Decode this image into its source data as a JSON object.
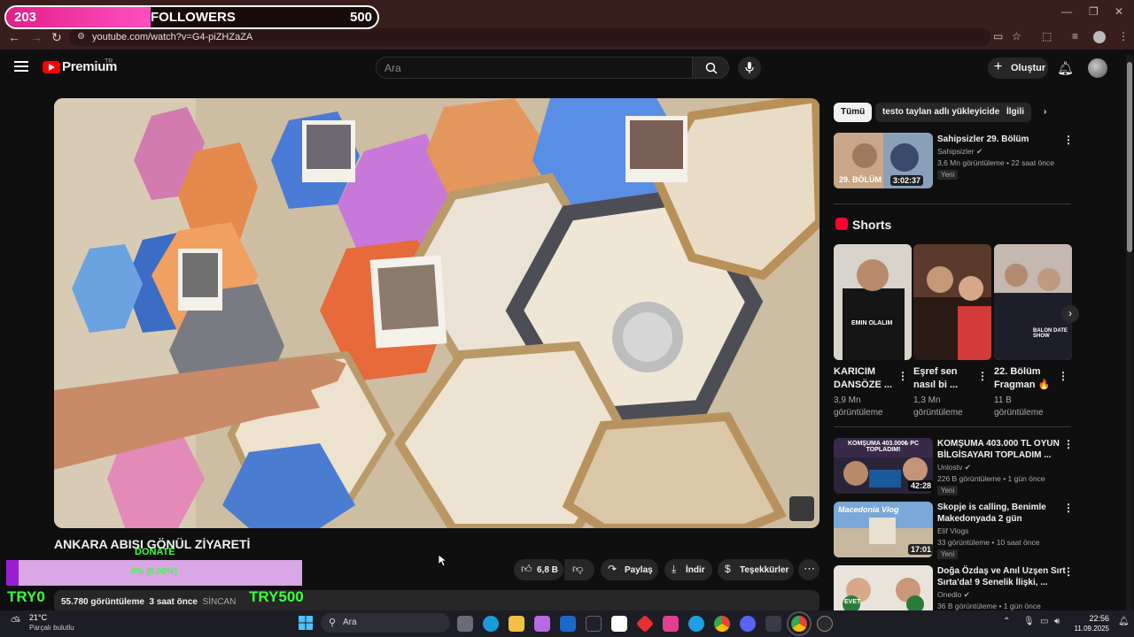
{
  "browser": {
    "url": "youtube.com/watch?v=G4-piZHZaZA"
  },
  "followers_overlay": {
    "count": "203",
    "label": "FOLLOWERS",
    "goal": "500",
    "progress_fraction": 0.39
  },
  "header": {
    "logo_text": "Premium",
    "logo_sup": "TR",
    "search_placeholder": "Ara",
    "create_label": "Oluştur"
  },
  "video": {
    "title": "ANKARA ABISI GÖNÜL ZİYARETİ",
    "views": "55.780 görüntüleme",
    "age": "3 saat önce",
    "location": "SİNCAN",
    "like_count": "6,8 B",
    "share_label": "Paylaş",
    "download_label": "İndir",
    "thanks_label": "Teşekkürler"
  },
  "donate_overlay": {
    "label": "DONATE",
    "percent_text": "0% (0.00%)",
    "min": "TRY0",
    "max": "TRY500",
    "progress_fraction": 0.0
  },
  "sidebar": {
    "chips": [
      "Tümü",
      "testo taylan adlı yükleyiciden",
      "İlgili"
    ],
    "top_video": {
      "title": "Sahipsizler 29. Bölüm",
      "channel": "Sahipsizler",
      "meta": "3,6 Mn görüntüleme • 22 saat önce",
      "badge": "Yeni",
      "overlay_text": "29. BÖLÜM",
      "duration": "3:02:37"
    },
    "shorts_title": "Shorts",
    "shorts": [
      {
        "title1": "KARICIM",
        "title2": "DANSÖZE ...",
        "views1": "3,9 Mn",
        "views2": "görüntüleme",
        "overlay": "EMIN OLALIM"
      },
      {
        "title1": "Eşref sen",
        "title2": "nasıl bi ...",
        "views1": "1,3 Mn",
        "views2": "görüntüleme",
        "overlay": ""
      },
      {
        "title1": "22. Bölüm",
        "title2": "Fragman 🔥",
        "views1": "11 B",
        "views2": "görüntüleme",
        "overlay": "BALON DATE SHOW"
      }
    ],
    "videos": [
      {
        "title1": "KOMŞUMA 403.000 TL OYUN",
        "title2": "BİLGİSAYARI TOPLADIM ...",
        "channel": "Unlostv",
        "meta": "226 B görüntüleme • 1 gün önce",
        "badge": "Yeni",
        "duration": "42:28",
        "overlay": "KOMŞUMA 403.000₺ PC TOPLADIM!"
      },
      {
        "title1": "Skopje is calling, Benimle",
        "title2": "Makedonyada 2 gün",
        "channel": "Elif Vlogs",
        "meta": "33 görüntüleme • 10 saat önce",
        "badge": "Yeni",
        "duration": "17:01",
        "overlay": "Macedonia Vlog"
      },
      {
        "title1": "Doğa Özdaş ve Anıl Uzşen Sırt",
        "title2": "Sırta'da! 9 Senelik İlişki, ...",
        "channel": "Onedio",
        "meta": "36 B görüntüleme • 1 gün önce",
        "badge": "",
        "duration": "",
        "overlay": "EVET"
      }
    ]
  },
  "taskbar": {
    "weather_temp": "21°C",
    "weather_desc": "Parçalı bulutlu",
    "search_label": "Ara",
    "time": "22:56",
    "date": "11.09.2025"
  }
}
